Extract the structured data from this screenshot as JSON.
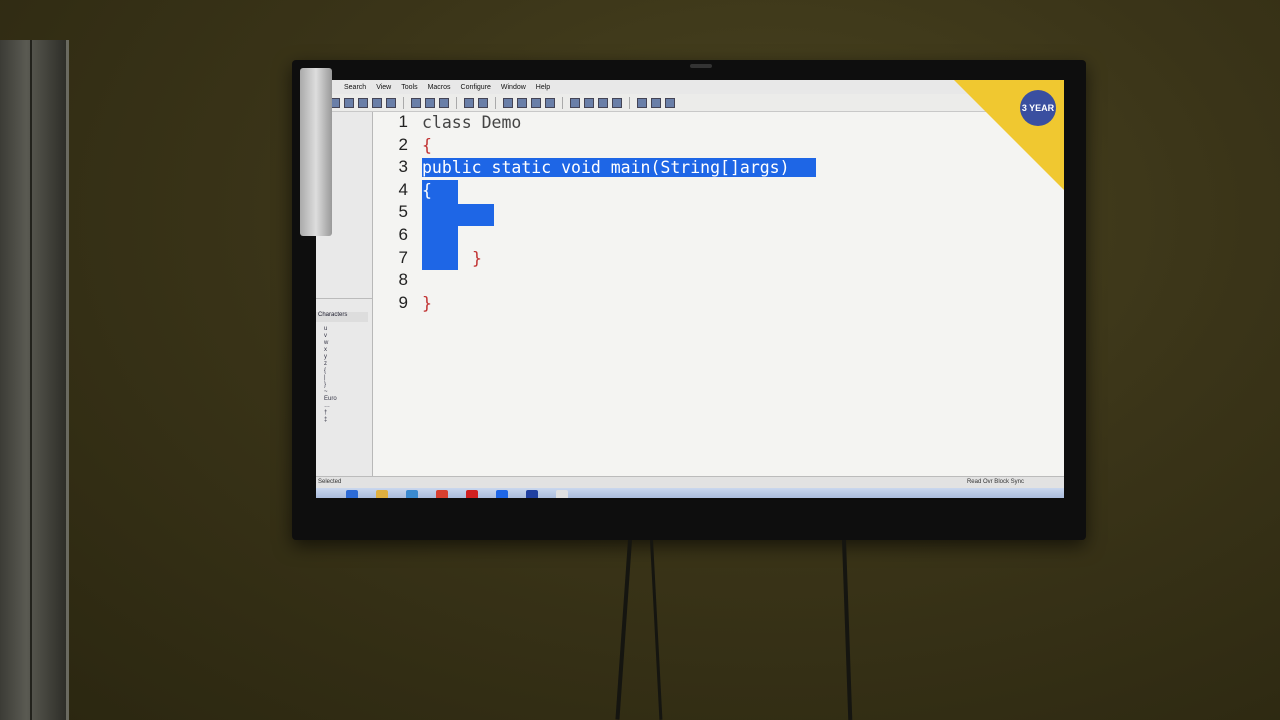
{
  "menu": {
    "items": [
      "Search",
      "View",
      "Tools",
      "Macros",
      "Configure",
      "Window",
      "Help"
    ]
  },
  "editor": {
    "line_numbers": [
      "1",
      "2",
      "3",
      "4",
      "5",
      "6",
      "7",
      "8",
      "9"
    ],
    "lines": [
      "class Demo",
      "{",
      "public static void main(String[]args)",
      "{",
      "",
      "",
      "}",
      "",
      "}"
    ]
  },
  "sidebar": {
    "panel_title": "Characters",
    "list": [
      "u",
      "v",
      "w",
      "x",
      "y",
      "z",
      "{",
      "|",
      "}",
      "~",
      "",
      "Euro",
      "",
      "…",
      "†",
      "‡"
    ]
  },
  "status": {
    "left": "Selected",
    "right": "Read  Ovr  Block  Sync"
  },
  "sticker": {
    "badge": "3 YEAR"
  },
  "colors": {
    "selection": "#1e66e6",
    "brace": "#c03030"
  }
}
